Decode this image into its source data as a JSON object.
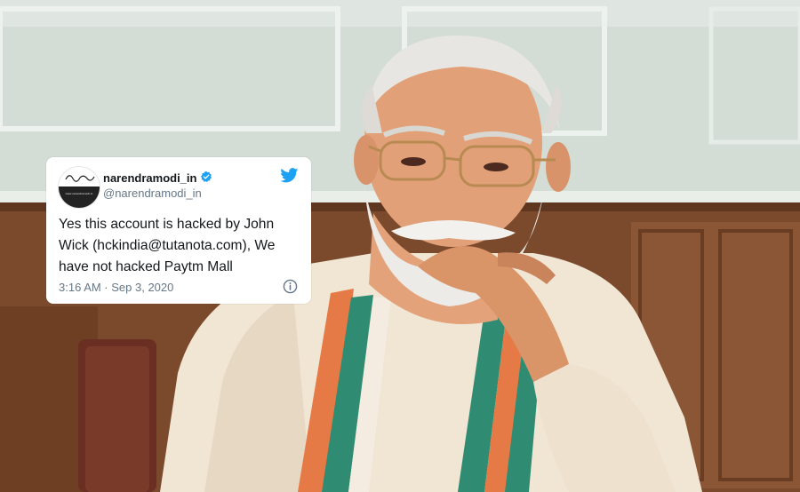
{
  "tweet": {
    "display_name": "narendramodi_in",
    "handle": "@narendramodi_in",
    "text": "Yes this account is hacked by John Wick (hckindia@tutanota.com), We have not hacked Paytm Mall",
    "timestamp": "3:16 AM · Sep 3, 2020",
    "avatar_caption": "www.narendramodi.in"
  },
  "icons": {
    "verified": "verified-badge-icon",
    "brand": "twitter-bird-icon",
    "info": "info-icon"
  },
  "colors": {
    "twitter_blue": "#1da1f2",
    "card_bg": "#ffffff",
    "secondary_text": "#657786",
    "primary_text": "#14171a"
  }
}
